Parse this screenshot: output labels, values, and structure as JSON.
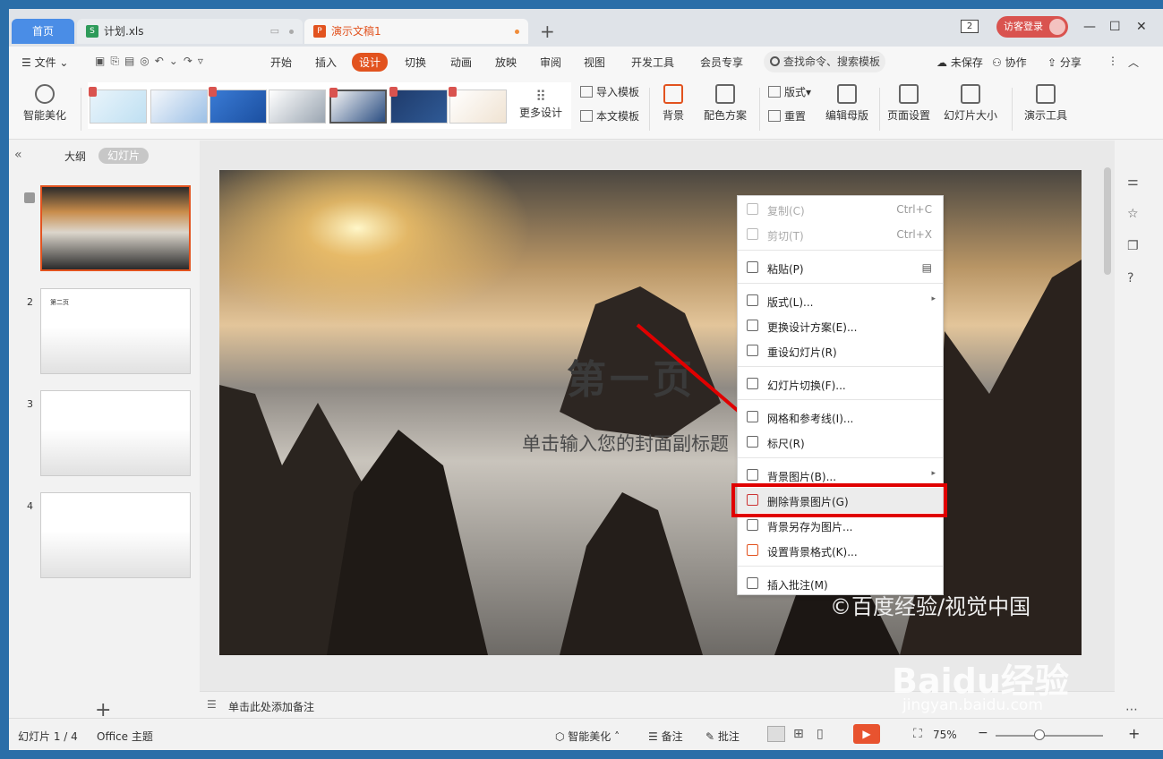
{
  "tabs": {
    "home": "首页",
    "file1": "计划.xls",
    "file2": "演示文稿1",
    "new_tab": "+"
  },
  "window": {
    "login": "访客登录",
    "badge": "2",
    "min": "—",
    "max": "☐",
    "close": "✕"
  },
  "menu": {
    "file": "文件",
    "items": [
      "开始",
      "插入",
      "设计",
      "切换",
      "动画",
      "放映",
      "审阅",
      "视图",
      "开发工具",
      "会员专享"
    ],
    "active_index": 2,
    "search": "查找命令、搜索模板",
    "unsaved": "未保存",
    "collab": "协作",
    "share": "分享"
  },
  "ribbon": {
    "smart_beauty": "智能美化",
    "more_design": "更多设计",
    "import_template": "导入模板",
    "this_template": "本文模板",
    "background": "背景",
    "color_scheme": "配色方案",
    "layout": "版式",
    "reset": "重置",
    "edit_master": "编辑母版",
    "page_setup": "页面设置",
    "slide_size": "幻灯片大小",
    "present_tools": "演示工具"
  },
  "left_panel": {
    "outline": "大纲",
    "slides": "幻灯片",
    "slide_numbers": [
      "2",
      "3",
      "4"
    ],
    "slide2_title": "第二页",
    "add": "+"
  },
  "slide": {
    "title": "第一页",
    "subtitle": "单击输入您的封面副标题",
    "watermark": "©百度经验/视觉中国"
  },
  "context_menu": {
    "copy": "复制(C)",
    "copy_key": "Ctrl+C",
    "cut": "剪切(T)",
    "cut_key": "Ctrl+X",
    "paste": "粘贴(P)",
    "layout": "版式(L)...",
    "change_design": "更换设计方案(E)...",
    "reset_slide": "重设幻灯片(R)",
    "transition": "幻灯片切换(F)...",
    "grid": "网格和参考线(I)...",
    "ruler": "标尺(R)",
    "bg_image": "背景图片(B)...",
    "delete_bg": "删除背景图片(G)",
    "save_bg": "背景另存为图片...",
    "set_bg_format": "设置背景格式(K)...",
    " insert_note": "插入批注(M)"
  },
  "notes": {
    "placeholder": "单击此处添加备注"
  },
  "status": {
    "slide_counter": "幻灯片 1 / 4",
    "theme": "Office 主题",
    "smart": "智能美化",
    "notes": "备注",
    "comment": "批注",
    "zoom": "75%"
  },
  "baidu": {
    "logo": "Baidu经验",
    "url": "jingyan.baidu.com"
  },
  "colors": {
    "accent": "#e2531f",
    "highlight": "#e00000",
    "tab_blue": "#4a8de6"
  }
}
